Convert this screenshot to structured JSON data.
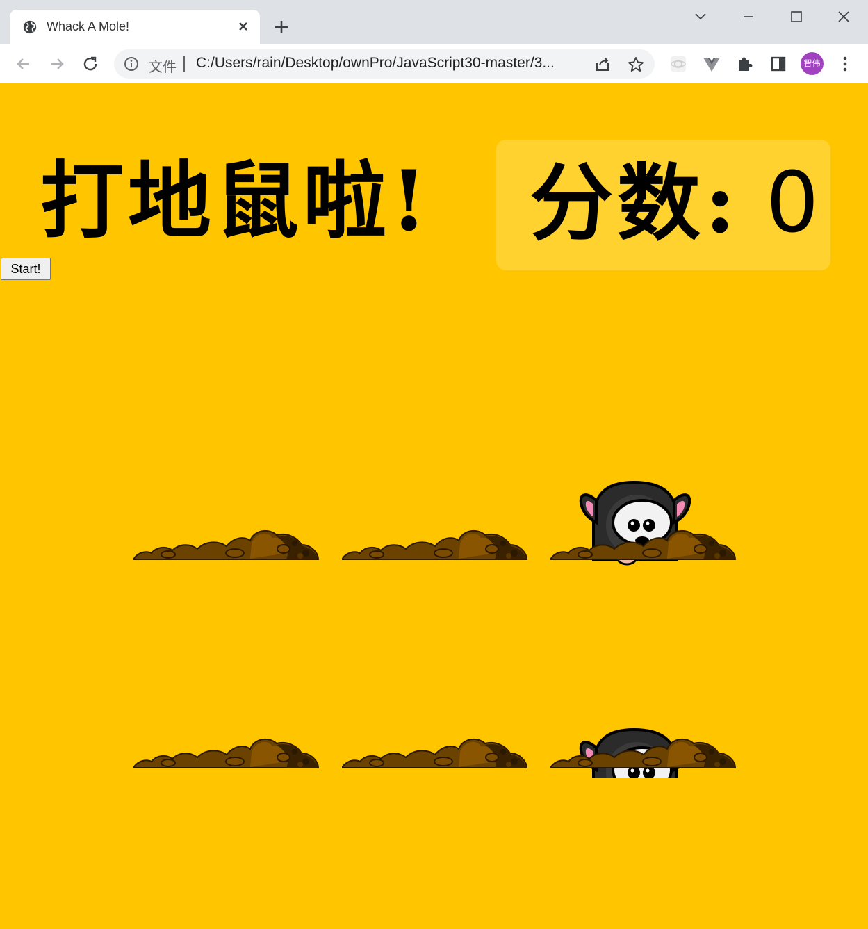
{
  "browser": {
    "tab_title": "Whack A Mole!",
    "protocol_label": "文件",
    "url": "C:/Users/rain/Desktop/ownPro/JavaScript30-master/3...",
    "profile_initials": "智伟",
    "icons": [
      "globe-icon",
      "close-icon",
      "plus-icon",
      "chevron-down-icon",
      "minimize-icon",
      "maximize-icon",
      "close-window-icon",
      "back-icon",
      "forward-icon",
      "reload-icon",
      "info-icon",
      "share-icon",
      "star-icon",
      "extension-icon",
      "vue-icon",
      "puzzle-icon",
      "sidepanel-icon",
      "kebab-menu-icon"
    ]
  },
  "game": {
    "title": "打地鼠啦!",
    "score_label": "分数:",
    "score_value": "0",
    "start_label": "Start!",
    "holes": [
      {
        "mole": "hidden"
      },
      {
        "mole": "hidden"
      },
      {
        "mole": "peek-high"
      },
      {
        "mole": "hidden"
      },
      {
        "mole": "hidden"
      },
      {
        "mole": "peek-low"
      }
    ],
    "colors": {
      "background": "#ffc600",
      "score_box": "#ffd230",
      "dirt": "#6b4200",
      "mole": "#2b2b2b"
    }
  }
}
